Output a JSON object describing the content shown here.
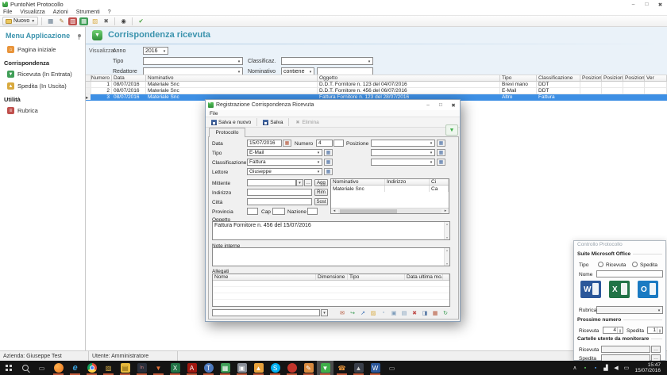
{
  "glyphs": {
    "minimize": "–",
    "maximize": "□",
    "close": "✖"
  },
  "colors": {
    "accent": "#3b93ad",
    "selection": "#3d8fe4",
    "logo_green": "#3fae49",
    "taskbar": "#141414"
  },
  "window": {
    "title": "PuntoNet Protocollo",
    "menus": [
      "File",
      "Visualizza",
      "Azioni",
      "Strumenti",
      "?"
    ],
    "new_button": "Nuovo"
  },
  "sidebar": {
    "title": "Menu Applicazione",
    "items": [
      {
        "label": "Pagina iniziale",
        "glyph": "⌂"
      },
      {
        "label": "Corrispondenza"
      },
      {
        "label": "Ricevuta (In Entrata)",
        "glyph": "▼"
      },
      {
        "label": "Spedita (In Uscita)",
        "glyph": "▲"
      },
      {
        "label": "Utilità"
      },
      {
        "label": "Rubrica",
        "glyph": "≡"
      }
    ]
  },
  "main": {
    "title": "Corrispondenza ricevuta",
    "filters": {
      "visualizza": "Visualizza:",
      "anno_label": "Anno",
      "anno_value": "2016",
      "tipo_label": "Tipo",
      "tipo_value": "",
      "classificazione_label": "Classificaz.",
      "classificazione_value": "",
      "redattore_label": "Redattore",
      "redattore_value": "",
      "nominativo_label": "Nominativo",
      "operator_value": "contiene",
      "nominativo_value": ""
    },
    "grid": {
      "headers": {
        "numero": "Numero",
        "data": "Data",
        "nominativo": "Nominativo",
        "oggetto": "Oggetto",
        "tipo": "Tipo",
        "classificazione": "Classificazione",
        "pos1": "Posizione1",
        "pos2": "Posizione2",
        "pos3": "Posizione3",
        "ver": "Ver"
      },
      "rows": [
        {
          "ind": "",
          "numero": "1",
          "data": "08/07/2016",
          "nominativo": "Materiale Snc",
          "oggetto": "D.D.T. Fornitore n. 123 del 04/07/2016",
          "tipo": "Brevi mano",
          "classificazione": "DDT"
        },
        {
          "ind": "",
          "numero": "2",
          "data": "08/07/2016",
          "nominativo": "Materiale Snc",
          "oggetto": "D.D.T. Fornitore n. 456 del 06/07/2016",
          "tipo": "E-Mail",
          "classificazione": "DDT"
        },
        {
          "ind": "▸",
          "numero": "3",
          "data": "08/07/2016",
          "nominativo": "Materiale Snc",
          "oggetto": "Fattura Fornitore n. 123 del 28/07/2016",
          "tipo": "Altro",
          "classificazione": "Fattura"
        }
      ]
    }
  },
  "dialog": {
    "title": "Registrazione Corrispondenza Ricevuta",
    "menu": "File",
    "buttons": {
      "save_new": "Salva e nuovo",
      "save": "Salva",
      "delete": "Elimina"
    },
    "tab": "Protocollo",
    "fields": {
      "data_label": "Data",
      "data_value": "15/07/2016",
      "numero_label": "Numero",
      "numero_value": "4",
      "numero2_value": "",
      "posizione_label": "Posizione",
      "pos1_value": "",
      "pos2_value": "",
      "pos3_value": "",
      "tipo_label": "Tipo",
      "tipo_value": "E-Mail",
      "classificazione_label": "Classificazione",
      "classificazione_value": "Fattura",
      "lettore_label": "Lettore",
      "lettore_value": "Giuseppe",
      "mittente_label": "Mittente",
      "mittente_value": "",
      "indirizzo_label": "Indirizzo",
      "indirizzo_value": "",
      "citta_label": "Città",
      "citta_value": "",
      "provincia_label": "Provincia",
      "provincia_value": "",
      "cap_label": "Cap",
      "cap_value": "",
      "nazione_label": "Nazione",
      "nazione_value": "",
      "agg": "Agg",
      "rim": "Rim",
      "sost": "Sost",
      "oggetto_label": "Oggetto",
      "oggetto_value": "Fattura Fornitore n. 456 del 15/07/2016",
      "note_label": "Note interne",
      "note_value": "",
      "allegati_label": "Allegati",
      "attach_value": ""
    },
    "contacts": {
      "headers": [
        "Nominativo",
        "Indirizzo",
        "Ci"
      ],
      "row": [
        "Materiale Snc",
        "",
        "Ca"
      ]
    },
    "allegati_headers": [
      "Nome",
      "Dimensione",
      "Tipo",
      "Data ultima mo...",
      ""
    ]
  },
  "panel": {
    "title": "Controllo Protocollo",
    "sections": {
      "office": "Suite Microsoft Office",
      "next": "Prossimo numero",
      "folders": "Cartelle utente da monitorare"
    },
    "tipo_label": "Tipo",
    "radio_ricevuta": "Ricevuta",
    "radio_spedita": "Spedita",
    "nome_label": "Nome",
    "nome_value": "",
    "rubrica_label": "Rubrica",
    "rubrica_value": "",
    "ricevuta_label": "Ricevuta",
    "ricevuta_value": "4",
    "spedita_label": "Spedita",
    "spedita_value": "1",
    "cart_ricevuta_label": "Ricevuta",
    "cart_ricevuta_value": "",
    "cart_spedita_label": "Spedita",
    "cart_spedita_value": ""
  },
  "statusbar": {
    "azienda": "Azienda: Giuseppe Test",
    "utente": "Utente: Amministratore"
  },
  "taskbar": {
    "time": "15:47",
    "date": "15/07/2016"
  },
  "icons": {
    "main_toolbar": [
      {
        "name": "print-icon",
        "glyph": "▦",
        "fg": "#60768a"
      },
      {
        "name": "edit-icon",
        "glyph": "✎",
        "fg": "#a8803a"
      },
      {
        "name": "export-pdf-icon",
        "glyph": "▥",
        "bg": "#c0504d",
        "fg": "#fff"
      },
      {
        "name": "export-excel-icon",
        "glyph": "▦",
        "bg": "#3f9e57",
        "fg": "#fff"
      },
      {
        "name": "open-folder-icon",
        "glyph": "▨",
        "fg": "#d8a93e"
      },
      {
        "name": "delete-icon",
        "glyph": "✖",
        "fg": "#666"
      }
    ],
    "search_tool": [
      {
        "name": "search-icon",
        "glyph": "◉",
        "fg": "#3a3a3a"
      }
    ],
    "confirm_tool": [
      {
        "name": "confirm-icon",
        "glyph": "✔",
        "fg": "#44a03c"
      }
    ],
    "office": [
      {
        "name": "word-icon",
        "cls": "off",
        "glyph": "W",
        "bg": "#2b579a"
      },
      {
        "name": "excel-icon",
        "cls": "off",
        "glyph": "X",
        "bg": "#217346"
      },
      {
        "name": "outlook-icon",
        "cls": "off",
        "glyph": "O",
        "bg": "#1a7ac2"
      }
    ],
    "attach_toolbar": [
      {
        "name": "mail-attachment-icon",
        "glyph": "✉",
        "fg": "#b5563a"
      },
      {
        "name": "acquire-icon",
        "glyph": "↪",
        "fg": "#3f9e57"
      },
      {
        "name": "send-icon",
        "glyph": "↗",
        "fg": "#3a6fb5"
      },
      {
        "name": "open-attachment-icon",
        "glyph": "▨",
        "fg": "#d8a93e"
      },
      {
        "name": "new-file-icon",
        "glyph": "▫",
        "fg": "#7d9cba"
      },
      {
        "name": "copy-file-icon",
        "glyph": "▣",
        "fg": "#7d9cba"
      },
      {
        "name": "save-file-icon",
        "glyph": "▤",
        "fg": "#7d9cba"
      },
      {
        "name": "delete-attachment-icon",
        "glyph": "✖",
        "fg": "#c0504d"
      },
      {
        "name": "preview-icon",
        "glyph": "◨",
        "fg": "#5a7ba6"
      },
      {
        "name": "print-attachment-icon",
        "glyph": "▦",
        "fg": "#b5563a"
      },
      {
        "name": "refresh-icon",
        "glyph": "↻",
        "fg": "#3f9e57"
      }
    ],
    "taskbar_sys": [
      {
        "name": "start-button",
        "cls": "winlogo"
      },
      {
        "name": "search-icon",
        "cls": "mag"
      },
      {
        "name": "task-view-icon",
        "glyph": "▭",
        "fg": "#cfcfcf"
      }
    ],
    "taskbar_apps": [
      {
        "name": "firefox-icon",
        "cls": "rnd run",
        "bg": "radial-gradient(circle at 35% 35%, #ffb350, #e8701a)"
      },
      {
        "name": "edge-icon",
        "cls": "edgi run",
        "glyph": "e",
        "fg": "#3aa0da"
      },
      {
        "name": "chrome-icon",
        "cls": "rnd chrome run",
        "bg": "conic-gradient(#dd4b39 0 120deg, #ffcd40 0 240deg, #0f9d58 0)"
      },
      {
        "name": "file-explorer-icon",
        "cls": "run",
        "glyph": "▨",
        "fg": "#e3b64a"
      },
      {
        "name": "notes-icon",
        "cls": "run",
        "glyph": "▤",
        "bg": "#e7b93c",
        "fg": "#7a5c10"
      },
      {
        "name": "indesign-icon",
        "cls": "tiny run",
        "glyph": "In",
        "bg": "#2a2f3a",
        "fg": "#d08080"
      },
      {
        "name": "filter-icon",
        "cls": "run",
        "glyph": "▼",
        "fg": "#e0713a"
      },
      {
        "name": "excel-icon",
        "cls": "run",
        "glyph": "X",
        "bg": "#217346",
        "fg": "#fff"
      },
      {
        "name": "acrobat-icon",
        "cls": "run",
        "glyph": "A",
        "bg": "#a11810",
        "fg": "#fff"
      },
      {
        "name": "teams-icon",
        "cls": "rnd run",
        "glyph": "T",
        "bg": "#4b78bc",
        "fg": "#fff"
      },
      {
        "name": "green-app-icon",
        "cls": "run",
        "glyph": "▦",
        "bg": "#3f9e57",
        "fg": "#fff"
      },
      {
        "name": "virtualbox-icon",
        "cls": "run",
        "glyph": "▣",
        "bg": "#8a8f98",
        "fg": "#fff"
      },
      {
        "name": "media-app-icon",
        "cls": "run",
        "glyph": "▲",
        "bg": "#e8a23c",
        "fg": "#fff"
      },
      {
        "name": "skype-icon",
        "cls": "rnd run",
        "glyph": "S",
        "bg": "#00aff0",
        "fg": "#fff"
      },
      {
        "name": "opera-icon",
        "cls": "rnd run",
        "bg": "#c1352b"
      },
      {
        "name": "paint-app-icon",
        "cls": "run",
        "glyph": "✎",
        "bg": "#d88a3f",
        "fg": "#fff"
      },
      {
        "name": "puntonet-icon",
        "cls": "active run",
        "glyph": "▼",
        "bg": "#3fae49",
        "fg": "#fff"
      },
      {
        "name": "phone-icon",
        "cls": "run",
        "glyph": "☎",
        "fg": "#e8943a"
      },
      {
        "name": "game-icon",
        "cls": "run",
        "glyph": "▲",
        "bg": "#3a3f4a",
        "fg": "#ccc"
      },
      {
        "name": "word-icon",
        "cls": "run",
        "glyph": "W",
        "bg": "#2b579a",
        "fg": "#fff"
      },
      {
        "name": "mouse-icon",
        "glyph": "▭",
        "fg": "#bbb"
      }
    ],
    "tray": [
      {
        "name": "tray-expand-icon",
        "glyph": "∧",
        "fg": "#ddd"
      },
      {
        "name": "tray-shield-icon",
        "glyph": "▪",
        "fg": "#57c05a"
      },
      {
        "name": "tray-sync-icon",
        "glyph": "▪",
        "fg": "#4a90d9"
      },
      {
        "name": "network-icon",
        "glyph": "▟",
        "fg": "#e8e8e8"
      },
      {
        "name": "volume-icon",
        "glyph": "◀",
        "fg": "#e8e8e8"
      },
      {
        "name": "notification-icon",
        "glyph": "▭",
        "fg": "#e8e8e8"
      }
    ]
  }
}
